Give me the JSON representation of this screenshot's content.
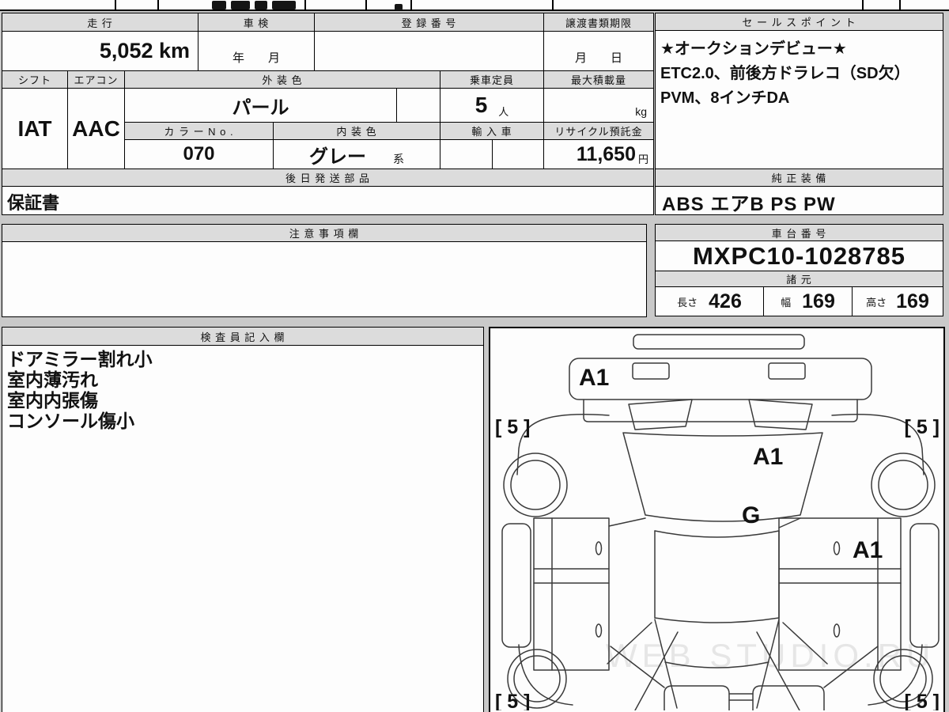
{
  "colors": {
    "page_bg": "#c9c9c9",
    "header_bg": "#dcdcdc",
    "cell_bg": "#fdfdfd",
    "border": "#000000",
    "diagram_line": "#3a3a3a",
    "watermark_gray": "#d8d8d8"
  },
  "top_table": {
    "mileage_label": "走 行",
    "mileage_value": "5,052 km",
    "shaken_label": "車 検",
    "shaken_value": "年　　月",
    "registration_label": "登 録 番 号",
    "registration_value": "",
    "transfer_doc_label": "譲渡書類期限",
    "transfer_doc_value": "月　　日",
    "shift_label": "シフト",
    "shift_value": "IAT",
    "aircon_label": "エアコン",
    "aircon_value": "AAC",
    "exterior_color_label": "外 装 色",
    "exterior_color_value": "パール",
    "capacity_label": "乗車定員",
    "capacity_value": "5",
    "capacity_unit": "人",
    "max_load_label": "最大積載量",
    "max_load_unit": "kg",
    "color_no_label": "カ ラ ー N o .",
    "color_no_value": "070",
    "interior_color_label": "内 装 色",
    "interior_color_value": "グレー",
    "interior_color_suffix": "系",
    "import_label": "輸 入 車",
    "recycle_label": "リサイクル預託金",
    "recycle_value": "11,650",
    "recycle_unit": "円"
  },
  "sales_point": {
    "label": "セ ー ル ス ポ イ ン ト",
    "lines": [
      "★オークションデビュー★",
      "ETC2.0、前後方ドラレコ（SD欠）",
      "PVM、8インチDA"
    ]
  },
  "later_parts": {
    "label": "後 日 発 送 部 品",
    "value": "保証書"
  },
  "genuine_equipment": {
    "label": "純 正 装 備",
    "value": "ABS エアB PS PW"
  },
  "notes": {
    "label": "注 意 事 項 欄",
    "value": ""
  },
  "chassis": {
    "label": "車 台 番 号",
    "value": "MXPC10-1028785"
  },
  "specs": {
    "label": "諸 元",
    "length_label": "長さ",
    "length_value": "426",
    "width_label": "幅",
    "width_value": "169",
    "height_label": "高さ",
    "height_value": "169"
  },
  "inspector": {
    "label": "検 査 員 記 入 欄",
    "lines": [
      "ドアミラー割れ小",
      "室内薄汚れ",
      "室内内張傷",
      "コンソール傷小"
    ]
  },
  "diagram": {
    "corner_mark": "[ 5 ]",
    "labels": {
      "hatch_grade": "A1",
      "rear_glass_grade": "A1",
      "gate_grade": "G",
      "right_door_grade": "A1"
    },
    "watermark": "WEB STUDIO.RU"
  }
}
